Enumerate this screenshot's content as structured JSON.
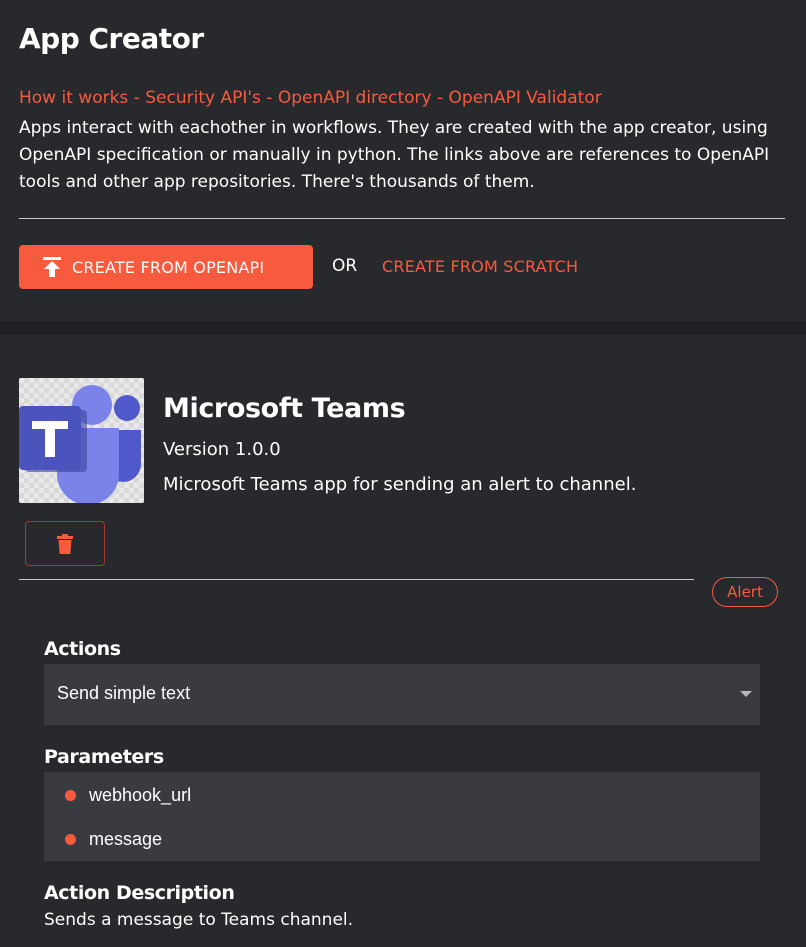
{
  "header": {
    "title": "App Creator",
    "links": [
      {
        "label": "How it works"
      },
      {
        "label": "Security API's"
      },
      {
        "label": "OpenAPI directory"
      },
      {
        "label": "OpenAPI Validator"
      }
    ],
    "separator": "-",
    "intro": "Apps interact with eachother in workflows. They are created with the app creator, using OpenAPI specification or manually in python. The links above are references to OpenAPI tools and other app repositories. There's thousands of them.",
    "create_openapi_label": "CREATE FROM OPENAPI",
    "or_label": "OR",
    "create_scratch_label": "CREATE FROM SCRATCH"
  },
  "app": {
    "name": "Microsoft Teams",
    "version": "Version 1.0.0",
    "description": "Microsoft Teams app for sending an alert to channel.",
    "logo_icon": "microsoft-teams-logo",
    "delete_icon": "trash-icon",
    "category_chip": "Alert",
    "actions_label": "Actions",
    "selected_action": "Send simple text",
    "parameters_label": "Parameters",
    "parameters": [
      "webhook_url",
      "message"
    ],
    "action_description_label": "Action Description",
    "action_description": "Sends a message to Teams channel."
  },
  "colors": {
    "background": "#27292d",
    "accent": "#f85a3e",
    "field_background": "#393b40",
    "text": "#ffffff"
  }
}
